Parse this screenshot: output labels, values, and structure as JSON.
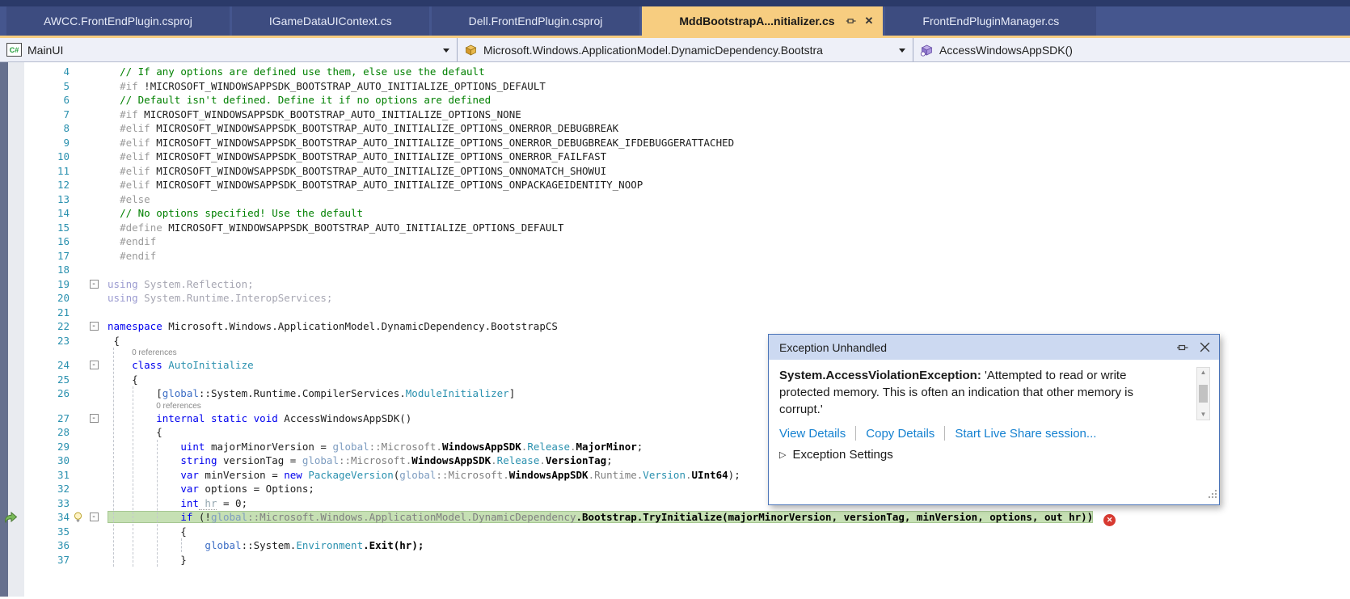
{
  "colors": {
    "tab-active-bg": "#f7cd80",
    "line-highlight": "#c6e0b4",
    "error-red": "#d73a31",
    "link-blue": "#1581d0",
    "popup-header-bg": "#ccd9f1",
    "keyword-blue": "#0000ee",
    "comment-green": "#008000",
    "type-teal": "#2b91af"
  },
  "tab_bar": {
    "tabs": [
      {
        "label": "AWCC.FrontEndPlugin.csproj",
        "active": false
      },
      {
        "label": "IGameDataUIContext.cs",
        "active": false
      },
      {
        "label": "Dell.FrontEndPlugin.csproj",
        "active": false
      },
      {
        "label": "MddBootstrapA...nitializer.cs",
        "active": true
      },
      {
        "label": "FrontEndPluginManager.cs",
        "active": false
      }
    ]
  },
  "navbar": {
    "project_selector": {
      "label": "MainUI",
      "icon": "csharp-project-icon"
    },
    "type_selector": {
      "label": "Microsoft.Windows.ApplicationModel.DynamicDependency.Bootstra",
      "icon": "class-icon"
    },
    "member_selector": {
      "label": "AccessWindowsAppSDK()",
      "icon": "method-icon"
    }
  },
  "editor": {
    "lines": [
      {
        "n": 4,
        "segs": [
          [
            "pl",
            "  "
          ],
          [
            "cm",
            "// If any options are defined use them, else use the default"
          ]
        ]
      },
      {
        "n": 5,
        "segs": [
          [
            "pl",
            "  "
          ],
          [
            "pp",
            "#if "
          ],
          [
            "ppw",
            "!MICROSOFT_WINDOWSAPPSDK_BOOTSTRAP_AUTO_INITIALIZE_OPTIONS_DEFAULT"
          ]
        ]
      },
      {
        "n": 6,
        "segs": [
          [
            "pl",
            "  "
          ],
          [
            "cm",
            "// Default isn't defined. Define it if no options are defined"
          ]
        ]
      },
      {
        "n": 7,
        "segs": [
          [
            "pl",
            "  "
          ],
          [
            "pp",
            "#if "
          ],
          [
            "ppw",
            "MICROSOFT_WINDOWSAPPSDK_BOOTSTRAP_AUTO_INITIALIZE_OPTIONS_NONE"
          ]
        ]
      },
      {
        "n": 8,
        "segs": [
          [
            "pl",
            "  "
          ],
          [
            "pp",
            "#elif "
          ],
          [
            "ppw",
            "MICROSOFT_WINDOWSAPPSDK_BOOTSTRAP_AUTO_INITIALIZE_OPTIONS_ONERROR_DEBUGBREAK"
          ]
        ]
      },
      {
        "n": 9,
        "segs": [
          [
            "pl",
            "  "
          ],
          [
            "pp",
            "#elif "
          ],
          [
            "ppw",
            "MICROSOFT_WINDOWSAPPSDK_BOOTSTRAP_AUTO_INITIALIZE_OPTIONS_ONERROR_DEBUGBREAK_IFDEBUGGERATTACHED"
          ]
        ]
      },
      {
        "n": 10,
        "segs": [
          [
            "pl",
            "  "
          ],
          [
            "pp",
            "#elif "
          ],
          [
            "ppw",
            "MICROSOFT_WINDOWSAPPSDK_BOOTSTRAP_AUTO_INITIALIZE_OPTIONS_ONERROR_FAILFAST"
          ]
        ]
      },
      {
        "n": 11,
        "segs": [
          [
            "pl",
            "  "
          ],
          [
            "pp",
            "#elif "
          ],
          [
            "ppw",
            "MICROSOFT_WINDOWSAPPSDK_BOOTSTRAP_AUTO_INITIALIZE_OPTIONS_ONNOMATCH_SHOWUI"
          ]
        ]
      },
      {
        "n": 12,
        "segs": [
          [
            "pl",
            "  "
          ],
          [
            "pp",
            "#elif "
          ],
          [
            "ppw",
            "MICROSOFT_WINDOWSAPPSDK_BOOTSTRAP_AUTO_INITIALIZE_OPTIONS_ONPACKAGEIDENTITY_NOOP"
          ]
        ]
      },
      {
        "n": 13,
        "segs": [
          [
            "pl",
            "  "
          ],
          [
            "pp",
            "#else"
          ]
        ]
      },
      {
        "n": 14,
        "segs": [
          [
            "pl",
            "  "
          ],
          [
            "cm",
            "// No options specified! Use the default"
          ]
        ]
      },
      {
        "n": 15,
        "segs": [
          [
            "pl",
            "  "
          ],
          [
            "pp",
            "#define "
          ],
          [
            "ppw",
            "MICROSOFT_WINDOWSAPPSDK_BOOTSTRAP_AUTO_INITIALIZE_OPTIONS_DEFAULT"
          ]
        ]
      },
      {
        "n": 16,
        "segs": [
          [
            "pl",
            "  "
          ],
          [
            "pp",
            "#endif"
          ]
        ]
      },
      {
        "n": 17,
        "segs": [
          [
            "pl",
            "  "
          ],
          [
            "pp",
            "#endif"
          ]
        ]
      },
      {
        "n": 18,
        "segs": []
      },
      {
        "n": 19,
        "fold": true,
        "segs": [
          [
            "dimkw",
            "using"
          ],
          [
            "dim",
            " System.Reflection;"
          ]
        ]
      },
      {
        "n": 20,
        "segs": [
          [
            "dimkw",
            "using"
          ],
          [
            "dim",
            " System.Runtime.InteropServices;"
          ]
        ]
      },
      {
        "n": 21,
        "segs": []
      },
      {
        "n": 22,
        "fold": true,
        "segs": [
          [
            "kw",
            "namespace"
          ],
          [
            "pl",
            " Microsoft.Windows.ApplicationModel.DynamicDependency.BootstrapCS"
          ]
        ]
      },
      {
        "n": 23,
        "segs": [
          [
            "pl",
            " {"
          ]
        ]
      },
      {
        "n": 24,
        "fold": true,
        "lens": "0 references",
        "lensIndent": 4,
        "segs": [
          [
            "pl",
            "    "
          ],
          [
            "kw",
            "class"
          ],
          [
            "t",
            " AutoInitialize"
          ]
        ]
      },
      {
        "n": 25,
        "segs": [
          [
            "pl",
            "    {"
          ]
        ]
      },
      {
        "n": 26,
        "segs": [
          [
            "pl",
            "        ["
          ],
          [
            "kw2",
            "global"
          ],
          [
            "pl",
            "::System.Runtime.CompilerServices."
          ],
          [
            "t",
            "ModuleInitializer"
          ],
          [
            "pl",
            "]"
          ]
        ]
      },
      {
        "n": 27,
        "fold": true,
        "lens": "0 references",
        "lensIndent": 8,
        "segs": [
          [
            "pl",
            "        "
          ],
          [
            "kw",
            "internal"
          ],
          [
            "pl",
            " "
          ],
          [
            "kw",
            "static"
          ],
          [
            "pl",
            " "
          ],
          [
            "kw",
            "void"
          ],
          [
            "pl",
            " AccessWindowsAppSDK()"
          ]
        ]
      },
      {
        "n": 28,
        "segs": [
          [
            "pl",
            "        {"
          ]
        ]
      },
      {
        "n": 29,
        "segs": [
          [
            "pl",
            "            "
          ],
          [
            "kw",
            "uint"
          ],
          [
            "pl",
            " majorMinorVersion = "
          ],
          [
            "kws",
            "global"
          ],
          [
            "g",
            "::Microsoft."
          ],
          [
            "id",
            "WindowsAppSDK"
          ],
          [
            "g",
            "."
          ],
          [
            "t",
            "Release"
          ],
          [
            "g",
            "."
          ],
          [
            "id",
            "MajorMinor"
          ],
          [
            "pl",
            ";"
          ]
        ]
      },
      {
        "n": 30,
        "segs": [
          [
            "pl",
            "            "
          ],
          [
            "kw",
            "string"
          ],
          [
            "pl",
            " versionTag = "
          ],
          [
            "kws",
            "global"
          ],
          [
            "g",
            "::Microsoft."
          ],
          [
            "id",
            "WindowsAppSDK"
          ],
          [
            "g",
            "."
          ],
          [
            "t",
            "Release"
          ],
          [
            "g",
            "."
          ],
          [
            "id",
            "VersionTag"
          ],
          [
            "pl",
            ";"
          ]
        ]
      },
      {
        "n": 31,
        "segs": [
          [
            "pl",
            "            "
          ],
          [
            "kw",
            "var"
          ],
          [
            "pl",
            " minVersion = "
          ],
          [
            "kw",
            "new"
          ],
          [
            "pl",
            " "
          ],
          [
            "t",
            "PackageVersion"
          ],
          [
            "pl",
            "("
          ],
          [
            "kws",
            "global"
          ],
          [
            "g",
            "::Microsoft."
          ],
          [
            "id",
            "WindowsAppSDK"
          ],
          [
            "g",
            ".Runtime."
          ],
          [
            "t",
            "Version"
          ],
          [
            "g",
            "."
          ],
          [
            "id",
            "UInt64"
          ],
          [
            "pl",
            ");"
          ]
        ]
      },
      {
        "n": 32,
        "segs": [
          [
            "pl",
            "            "
          ],
          [
            "kw",
            "var"
          ],
          [
            "pl",
            " options = Options;"
          ]
        ]
      },
      {
        "n": 33,
        "segs": [
          [
            "pl",
            "            "
          ],
          [
            "kw",
            "int"
          ],
          [
            "fade",
            " hr"
          ],
          [
            "pl",
            " = 0;"
          ]
        ]
      },
      {
        "n": 34,
        "fold": true,
        "bulb": true,
        "arrow": true,
        "error": true,
        "hl": true,
        "segs": [
          [
            "pl",
            "            "
          ],
          [
            "kw",
            "if"
          ],
          [
            "pl",
            " (!"
          ],
          [
            "kws",
            "global"
          ],
          [
            "g",
            "::Microsoft.Windows.ApplicationModel.DynamicDependency"
          ],
          [
            "id",
            ".Bootstrap.TryInitialize(majorMinorVersion, versionTag, minVersion, options, out hr))"
          ]
        ]
      },
      {
        "n": 35,
        "segs": [
          [
            "pl",
            "            {"
          ]
        ]
      },
      {
        "n": 36,
        "segs": [
          [
            "pl",
            "                "
          ],
          [
            "kw2",
            "global"
          ],
          [
            "pl",
            "::System."
          ],
          [
            "t",
            "Environment"
          ],
          [
            "id",
            ".Exit(hr);"
          ]
        ]
      },
      {
        "n": 37,
        "segs": [
          [
            "pl",
            "            }"
          ]
        ]
      }
    ]
  },
  "popup": {
    "title": "Exception Unhandled",
    "exception_type": "System.AccessViolationException:",
    "message": " 'Attempted to read or write protected memory. This is often an indication that other memory is corrupt.'",
    "links": [
      "View Details",
      "Copy Details",
      "Start Live Share session..."
    ],
    "settings_label": "Exception Settings"
  }
}
